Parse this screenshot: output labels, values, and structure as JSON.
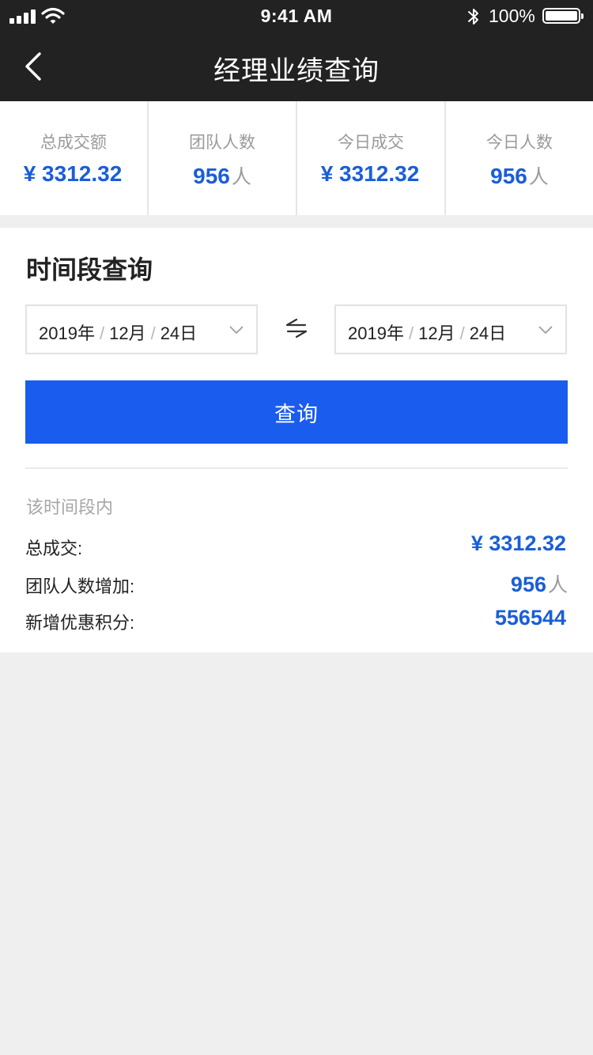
{
  "status_bar": {
    "time": "9:41 AM",
    "battery": "100%"
  },
  "nav": {
    "title": "经理业绩查询"
  },
  "stats": [
    {
      "label": "总成交额",
      "value": "¥ 3312.32",
      "unit": ""
    },
    {
      "label": "团队人数",
      "value": "956",
      "unit": "人"
    },
    {
      "label": "今日成交",
      "value": "¥ 3312.32",
      "unit": ""
    },
    {
      "label": "今日人数",
      "value": "956",
      "unit": "人"
    }
  ],
  "query": {
    "title": "时间段查询",
    "start": {
      "year": "2019年",
      "month": "12月",
      "day": "24日",
      "sep": "/"
    },
    "end": {
      "year": "2019年",
      "month": "12月",
      "day": "24日",
      "sep": "/"
    },
    "button_label": "查询"
  },
  "results": {
    "period_label": "该时间段内",
    "rows": [
      {
        "label": "总成交:",
        "value": "¥ 3312.32",
        "unit": ""
      },
      {
        "label": "团队人数增加:",
        "value": "956",
        "unit": "人"
      },
      {
        "label": "新增优惠积分:",
        "value": "556544",
        "unit": ""
      }
    ]
  },
  "colors": {
    "accent": "#1a5ced",
    "value_blue": "#1a5ed8",
    "header_bg": "#222222",
    "page_bg": "#efefef"
  },
  "icons": {
    "back": "chevron-left-icon",
    "swap": "swap-arrows-icon",
    "dropdown": "chevron-down-icon"
  }
}
